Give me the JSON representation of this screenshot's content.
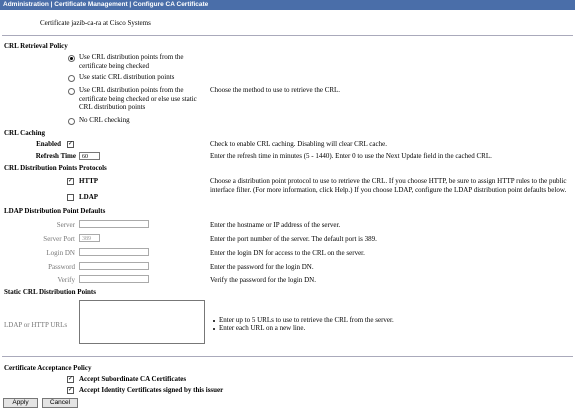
{
  "breadcrumb": "Administration | Certificate Management | Configure CA Certificate",
  "certificate": {
    "label": "Certificate",
    "value": "jazib-ca-ra at Cisco Systems"
  },
  "crl_retrieval": {
    "title": "CRL Retrieval Policy",
    "options": [
      "Use CRL distribution points from the certificate being checked",
      "Use static CRL distribution points",
      "Use CRL distribution points from the certificate being checked or else use static CRL distribution points",
      "No CRL checking"
    ],
    "selected_index": 0,
    "help": "Choose the method to use to retrieve the CRL."
  },
  "crl_caching": {
    "title": "CRL Caching",
    "enabled_label": "Enabled",
    "enabled": true,
    "enabled_help": "Check to enable CRL caching. Disabling will clear CRL cache.",
    "refresh_label": "Refresh Time",
    "refresh_value": "60",
    "refresh_help": "Enter the refresh time in minutes (5 - 1440). Enter 0 to use the Next Update field in the cached CRL."
  },
  "cdp_protocols": {
    "title": "CRL Distribution Points Protocols",
    "http_label": "HTTP",
    "http_checked": true,
    "ldap_label": "LDAP",
    "ldap_checked": false,
    "help": "Choose a distribution point protocol to use to retrieve the CRL. If you choose HTTP, be sure to assign HTTP rules to the public interface filter. (For more information, click Help.) If you choose LDAP, configure the LDAP distribution point defaults below."
  },
  "ldap_defaults": {
    "title": "LDAP Distribution Point Defaults",
    "server_label": "Server",
    "server_value": "",
    "server_help": "Enter the hostname or IP address of the server.",
    "port_label": "Server Port",
    "port_value": "389",
    "port_help": "Enter the port number of the server. The default port is 389.",
    "login_label": "Login DN",
    "login_value": "",
    "login_help": "Enter the login DN for access to the CRL on the server.",
    "password_label": "Password",
    "password_value": "",
    "password_help": "Enter the password for the login DN.",
    "verify_label": "Verify",
    "verify_value": "",
    "verify_help": "Verify the password for the login DN."
  },
  "static_cdp": {
    "title": "Static CRL Distribution Points",
    "urls_label": "LDAP or HTTP URLs",
    "urls_value": "",
    "help": [
      "Enter up to 5 URLs to use to retrieve the CRL from the server.",
      "Enter each URL on a new line."
    ]
  },
  "acceptance": {
    "title": "Certificate Acceptance Policy",
    "subordinate_label": "Accept Subordinate CA Certificates",
    "subordinate_checked": true,
    "identity_label": "Accept Identity Certificates signed by this issuer",
    "identity_checked": true
  },
  "buttons": {
    "apply": "Apply",
    "cancel": "Cancel"
  },
  "colors": {
    "header_bg": "#4a6ea9",
    "header_text": "#ffffff"
  }
}
